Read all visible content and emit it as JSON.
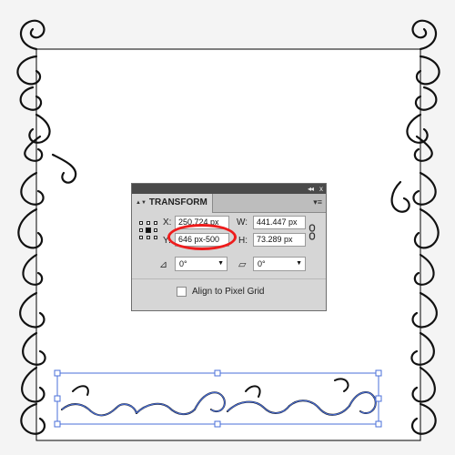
{
  "panel": {
    "title": "TRANSFORM",
    "tab_arrows": "▲▼",
    "collapse_glyph": "◂◂",
    "close_glyph": "x",
    "menu_glyph": "▾≡",
    "x_label": "X:",
    "x_value": "250.724 px",
    "y_label": "Y:",
    "y_value": "646 px-500",
    "w_label": "W:",
    "w_value": "441.447 px",
    "h_label": "H:",
    "h_value": "73.289 px",
    "rotate_value": "0°",
    "shear_value": "0°",
    "align_label": "Align to Pixel Grid",
    "align_checked": false
  },
  "colors": {
    "highlight_ring": "#ee1c1c",
    "selection": "#4a6fd8",
    "panel_bg": "#d6d6d6"
  },
  "icons": [
    "reference-point-icon",
    "link-proportions-icon",
    "rotate-icon",
    "shear-icon",
    "panel-menu-icon"
  ]
}
